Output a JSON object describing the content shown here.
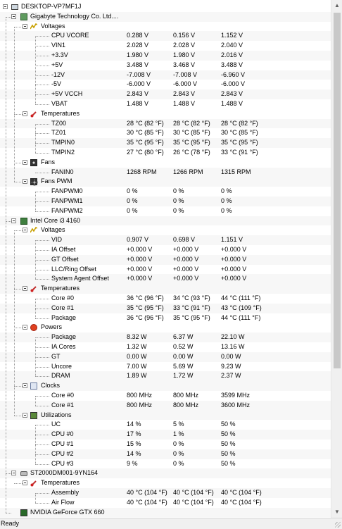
{
  "tree": {
    "root": "DESKTOP-VP7MF1J",
    "devices": [
      {
        "name": "Gigabyte Technology Co. Ltd....",
        "icon": "motherboard-icon",
        "groups": [
          {
            "name": "Voltages",
            "icon": "voltage-icon",
            "sensors": [
              [
                "CPU VCORE",
                "0.288 V",
                "0.156 V",
                "1.152 V"
              ],
              [
                "VIN1",
                "2.028 V",
                "2.028 V",
                "2.040 V"
              ],
              [
                "+3.3V",
                "1.980 V",
                "1.980 V",
                "2.016 V"
              ],
              [
                "+5V",
                "3.488 V",
                "3.468 V",
                "3.488 V"
              ],
              [
                "-12V",
                "-7.008 V",
                "-7.008 V",
                "-6.960 V"
              ],
              [
                "-5V",
                "-6.000 V",
                "-6.000 V",
                "-6.000 V"
              ],
              [
                "+5V VCCH",
                "2.843 V",
                "2.843 V",
                "2.843 V"
              ],
              [
                "VBAT",
                "1.488 V",
                "1.488 V",
                "1.488 V"
              ]
            ]
          },
          {
            "name": "Temperatures",
            "icon": "thermometer-icon",
            "sensors": [
              [
                "TZ00",
                "28 °C  (82 °F)",
                "28 °C  (82 °F)",
                "28 °C  (82 °F)"
              ],
              [
                "TZ01",
                "30 °C  (85 °F)",
                "30 °C  (85 °F)",
                "30 °C  (85 °F)"
              ],
              [
                "TMPIN0",
                "35 °C  (95 °F)",
                "35 °C  (95 °F)",
                "35 °C  (95 °F)"
              ],
              [
                "TMPIN2",
                "27 °C  (80 °F)",
                "26 °C  (78 °F)",
                "33 °C  (91 °F)"
              ]
            ]
          },
          {
            "name": "Fans",
            "icon": "fan-icon",
            "sensors": [
              [
                "FANIN0",
                "1268 RPM",
                "1266 RPM",
                "1315 RPM"
              ]
            ]
          },
          {
            "name": "Fans PWM",
            "icon": "fan-pwm-icon",
            "sensors": [
              [
                "FANPWM0",
                "0 %",
                "0 %",
                "0 %"
              ],
              [
                "FANPWM1",
                "0 %",
                "0 %",
                "0 %"
              ],
              [
                "FANPWM2",
                "0 %",
                "0 %",
                "0 %"
              ]
            ]
          }
        ]
      },
      {
        "name": "Intel Core i3 4160",
        "icon": "cpu-icon",
        "groups": [
          {
            "name": "Voltages",
            "icon": "voltage-icon",
            "sensors": [
              [
                "VID",
                "0.907 V",
                "0.698 V",
                "1.151 V"
              ],
              [
                "IA Offset",
                "+0.000 V",
                "+0.000 V",
                "+0.000 V"
              ],
              [
                "GT Offset",
                "+0.000 V",
                "+0.000 V",
                "+0.000 V"
              ],
              [
                "LLC/Ring Offset",
                "+0.000 V",
                "+0.000 V",
                "+0.000 V"
              ],
              [
                "System Agent Offset",
                "+0.000 V",
                "+0.000 V",
                "+0.000 V"
              ]
            ]
          },
          {
            "name": "Temperatures",
            "icon": "thermometer-icon",
            "sensors": [
              [
                "Core #0",
                "36 °C  (96 °F)",
                "34 °C  (93 °F)",
                "44 °C  (111 °F)"
              ],
              [
                "Core #1",
                "35 °C  (95 °F)",
                "33 °C  (91 °F)",
                "43 °C  (109 °F)"
              ],
              [
                "Package",
                "36 °C  (96 °F)",
                "35 °C  (95 °F)",
                "44 °C  (111 °F)"
              ]
            ]
          },
          {
            "name": "Powers",
            "icon": "power-icon",
            "sensors": [
              [
                "Package",
                "8.32 W",
                "6.37 W",
                "22.10 W"
              ],
              [
                "IA Cores",
                "1.32 W",
                "0.52 W",
                "13.16 W"
              ],
              [
                "GT",
                "0.00 W",
                "0.00 W",
                "0.00 W"
              ],
              [
                "Uncore",
                "7.00 W",
                "5.69 W",
                "9.23 W"
              ],
              [
                "DRAM",
                "1.89 W",
                "1.72 W",
                "2.37 W"
              ]
            ]
          },
          {
            "name": "Clocks",
            "icon": "clock-icon",
            "sensors": [
              [
                "Core #0",
                "800 MHz",
                "800 MHz",
                "3599 MHz"
              ],
              [
                "Core #1",
                "800 MHz",
                "800 MHz",
                "3600 MHz"
              ]
            ]
          },
          {
            "name": "Utilizations",
            "icon": "utilization-icon",
            "sensors": [
              [
                "UC",
                "14 %",
                "5 %",
                "50 %"
              ],
              [
                "CPU #0",
                "17 %",
                "1 %",
                "50 %"
              ],
              [
                "CPU #1",
                "15 %",
                "0 %",
                "50 %"
              ],
              [
                "CPU #2",
                "14 %",
                "0 %",
                "50 %"
              ],
              [
                "CPU #3",
                "9 %",
                "0 %",
                "50 %"
              ]
            ]
          }
        ]
      },
      {
        "name": "ST2000DM001-9YN164",
        "icon": "hard-drive-icon",
        "groups": [
          {
            "name": "Temperatures",
            "icon": "thermometer-icon",
            "sensors": [
              [
                "Assembly",
                "40 °C  (104 °F)",
                "40 °C  (104 °F)",
                "40 °C  (104 °F)"
              ],
              [
                "Air Flow",
                "40 °C  (104 °F)",
                "40 °C  (104 °F)",
                "40 °C  (104 °F)"
              ]
            ]
          }
        ]
      },
      {
        "name": "NVIDIA GeForce GTX 660",
        "icon": "gpu-icon",
        "groups": []
      }
    ]
  },
  "status": {
    "text": "Ready"
  }
}
